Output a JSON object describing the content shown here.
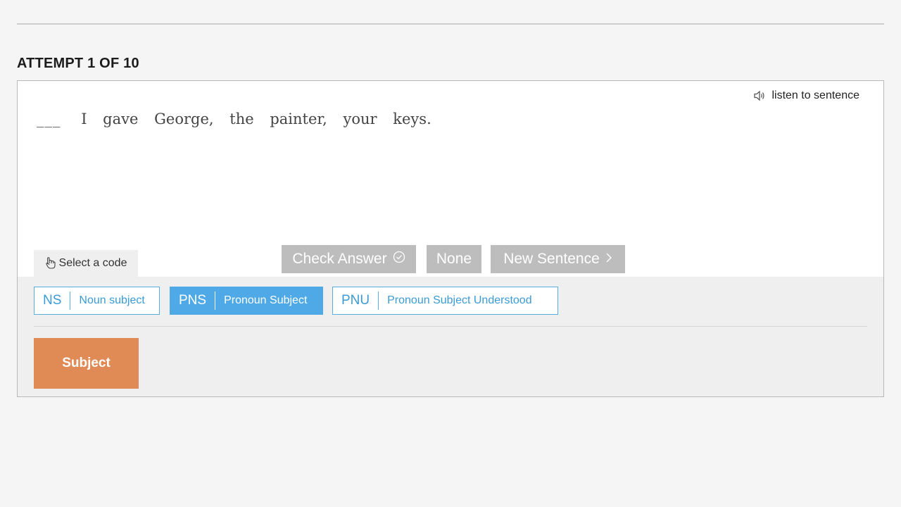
{
  "attempt_label": "ATTEMPT 1 OF 10",
  "listen_label": "listen to sentence",
  "sentence": {
    "blank": "___",
    "words": [
      "I",
      "gave",
      "George,",
      "the",
      "painter,",
      "your",
      "keys."
    ]
  },
  "select_code_label": "Select a code",
  "buttons": {
    "check_answer": "Check Answer",
    "none": "None",
    "new_sentence": "New Sentence"
  },
  "codes": [
    {
      "abbr": "NS",
      "label": "Noun subject",
      "selected": false
    },
    {
      "abbr": "PNS",
      "label": "Pronoun Subject",
      "selected": true
    },
    {
      "abbr": "PNU",
      "label": "Pronoun Subject Understood",
      "selected": false
    }
  ],
  "category_label": "Subject",
  "colors": {
    "accent_blue": "#4ea9e6",
    "subject_orange": "#e08a55",
    "disabled_gray": "#bdbdbd"
  },
  "icons": {
    "listen": "speaker-icon",
    "select_code": "pointing-hand-icon",
    "check_answer": "check-circle-icon",
    "new_sentence": "chevron-right-icon"
  }
}
